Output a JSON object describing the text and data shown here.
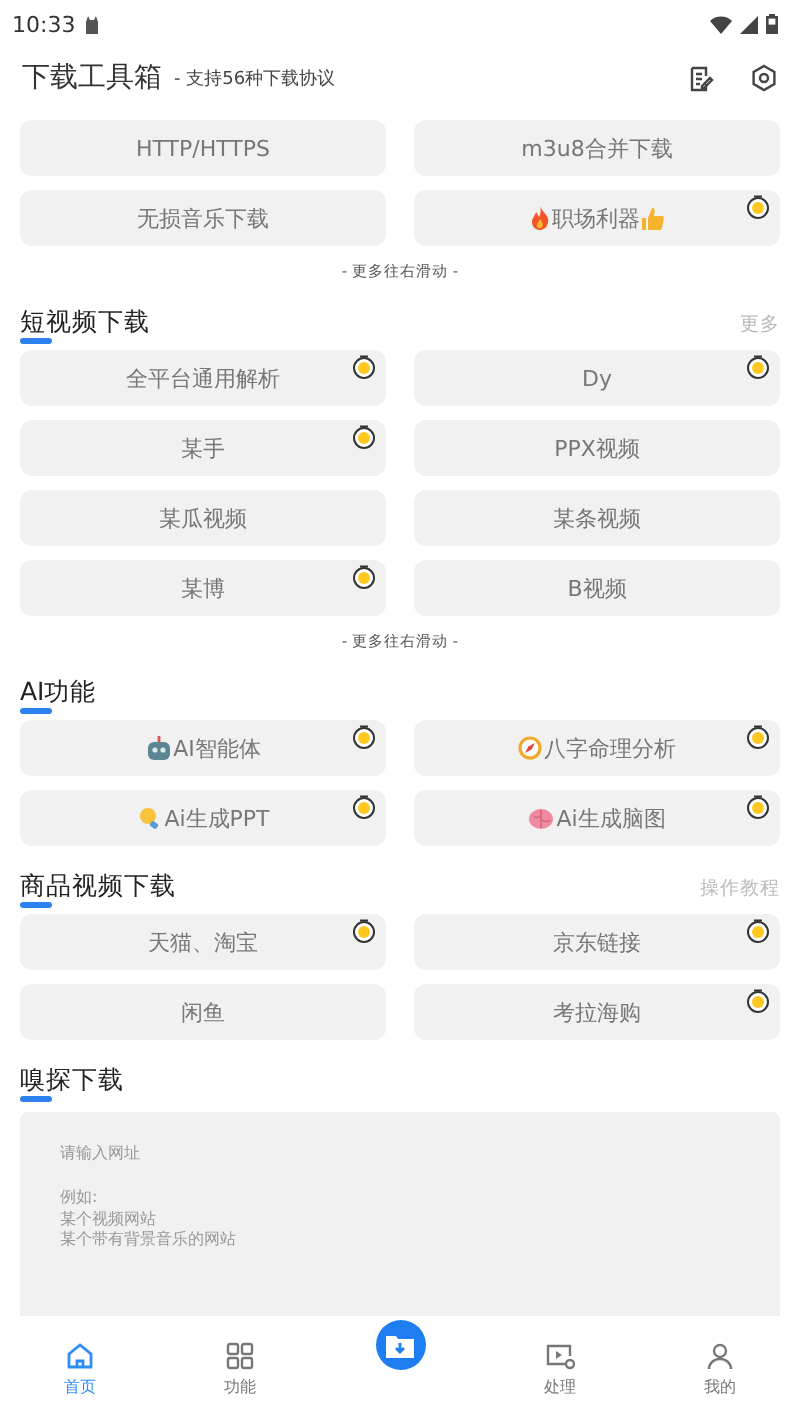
{
  "status_bar": {
    "time": "10:33"
  },
  "header": {
    "title": "下载工具箱",
    "subtitle": "- 支持56种下载协议"
  },
  "sections": [
    {
      "buttons": [
        {
          "label": "HTTP/HTTPS",
          "badge": false
        },
        {
          "label": "m3u8合并下载",
          "badge": false
        },
        {
          "label": "无损音乐下载",
          "badge": false
        },
        {
          "label": "职场利器",
          "badge": true
        }
      ],
      "hint": "- 更多往右滑动 -"
    },
    {
      "title": "短视频下载",
      "action": "更多",
      "buttons": [
        {
          "label": "全平台通用解析",
          "badge": true
        },
        {
          "label": "Dy",
          "badge": true
        },
        {
          "label": "某手",
          "badge": true
        },
        {
          "label": "PPX视频",
          "badge": false
        },
        {
          "label": "某瓜视频",
          "badge": false
        },
        {
          "label": "某条视频",
          "badge": false
        },
        {
          "label": "某博",
          "badge": true
        },
        {
          "label": "B视频",
          "badge": false
        }
      ],
      "hint": "- 更多往右滑动 -"
    },
    {
      "title": "AI功能",
      "buttons": [
        {
          "label": "AI智能体",
          "badge": true
        },
        {
          "label": "八字命理分析",
          "badge": true
        },
        {
          "label": "Ai生成PPT",
          "badge": true
        },
        {
          "label": "Ai生成脑图",
          "badge": true
        }
      ]
    },
    {
      "title": "商品视频下载",
      "action": "操作教程",
      "buttons": [
        {
          "label": "天猫、淘宝",
          "badge": true
        },
        {
          "label": "京东链接",
          "badge": true
        },
        {
          "label": "闲鱼",
          "badge": false
        },
        {
          "label": "考拉海购",
          "badge": true
        }
      ]
    }
  ],
  "sniff": {
    "title": "嗅探下载",
    "placeholder": [
      "请输入网址",
      "例如:",
      "某个视频网站",
      "某个带有背景音乐的网站"
    ]
  },
  "nav": [
    {
      "kind": "tab",
      "label": "首页",
      "selected": true
    },
    {
      "kind": "tab",
      "label": "功能",
      "selected": false
    },
    {
      "kind": "fab"
    },
    {
      "kind": "tab",
      "label": "处理",
      "selected": false
    },
    {
      "kind": "tab",
      "label": "我的",
      "selected": false
    }
  ]
}
